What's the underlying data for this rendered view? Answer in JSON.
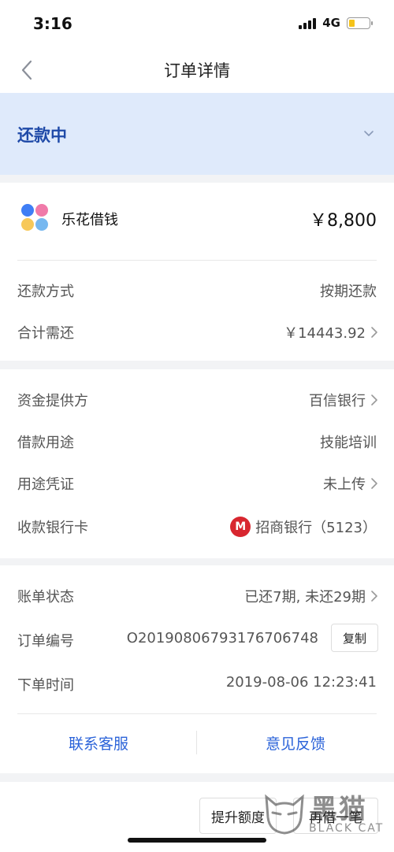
{
  "status_bar": {
    "time": "3:16",
    "network": "4G",
    "battery_level": 0.3
  },
  "nav": {
    "title": "订单详情"
  },
  "banner": {
    "label": "还款中"
  },
  "product": {
    "name": "乐花借钱",
    "amount": "￥8,800"
  },
  "repayment": {
    "method_label": "还款方式",
    "method_value": "按期还款",
    "total_label": "合计需还",
    "total_value": "￥14443.92"
  },
  "loan": {
    "provider_label": "资金提供方",
    "provider_value": "百信银行",
    "purpose_label": "借款用途",
    "purpose_value": "技能培训",
    "proof_label": "用途凭证",
    "proof_value": "未上传",
    "card_label": "收款银行卡",
    "card_value": "招商银行（5123）"
  },
  "order": {
    "bill_status_label": "账单状态",
    "bill_status_value": "已还7期, 未还29期",
    "order_no_label": "订单编号",
    "order_no_value": "O20190806793176706748",
    "copy_label": "复制",
    "time_label": "下单时间",
    "time_value": "2019-08-06 12:23:41",
    "contact_label": "联系客服",
    "feedback_label": "意见反馈"
  },
  "bottom": {
    "raise_limit_label": "提升额度",
    "borrow_again_label": "再借一笔"
  },
  "watermark": {
    "cn": "黑猫",
    "en": "BLACK CAT"
  },
  "colors": {
    "accent": "#2b63d9",
    "banner_bg": "#dfeafb",
    "banner_text": "#1f4aa8",
    "bank_red": "#d8262f"
  }
}
